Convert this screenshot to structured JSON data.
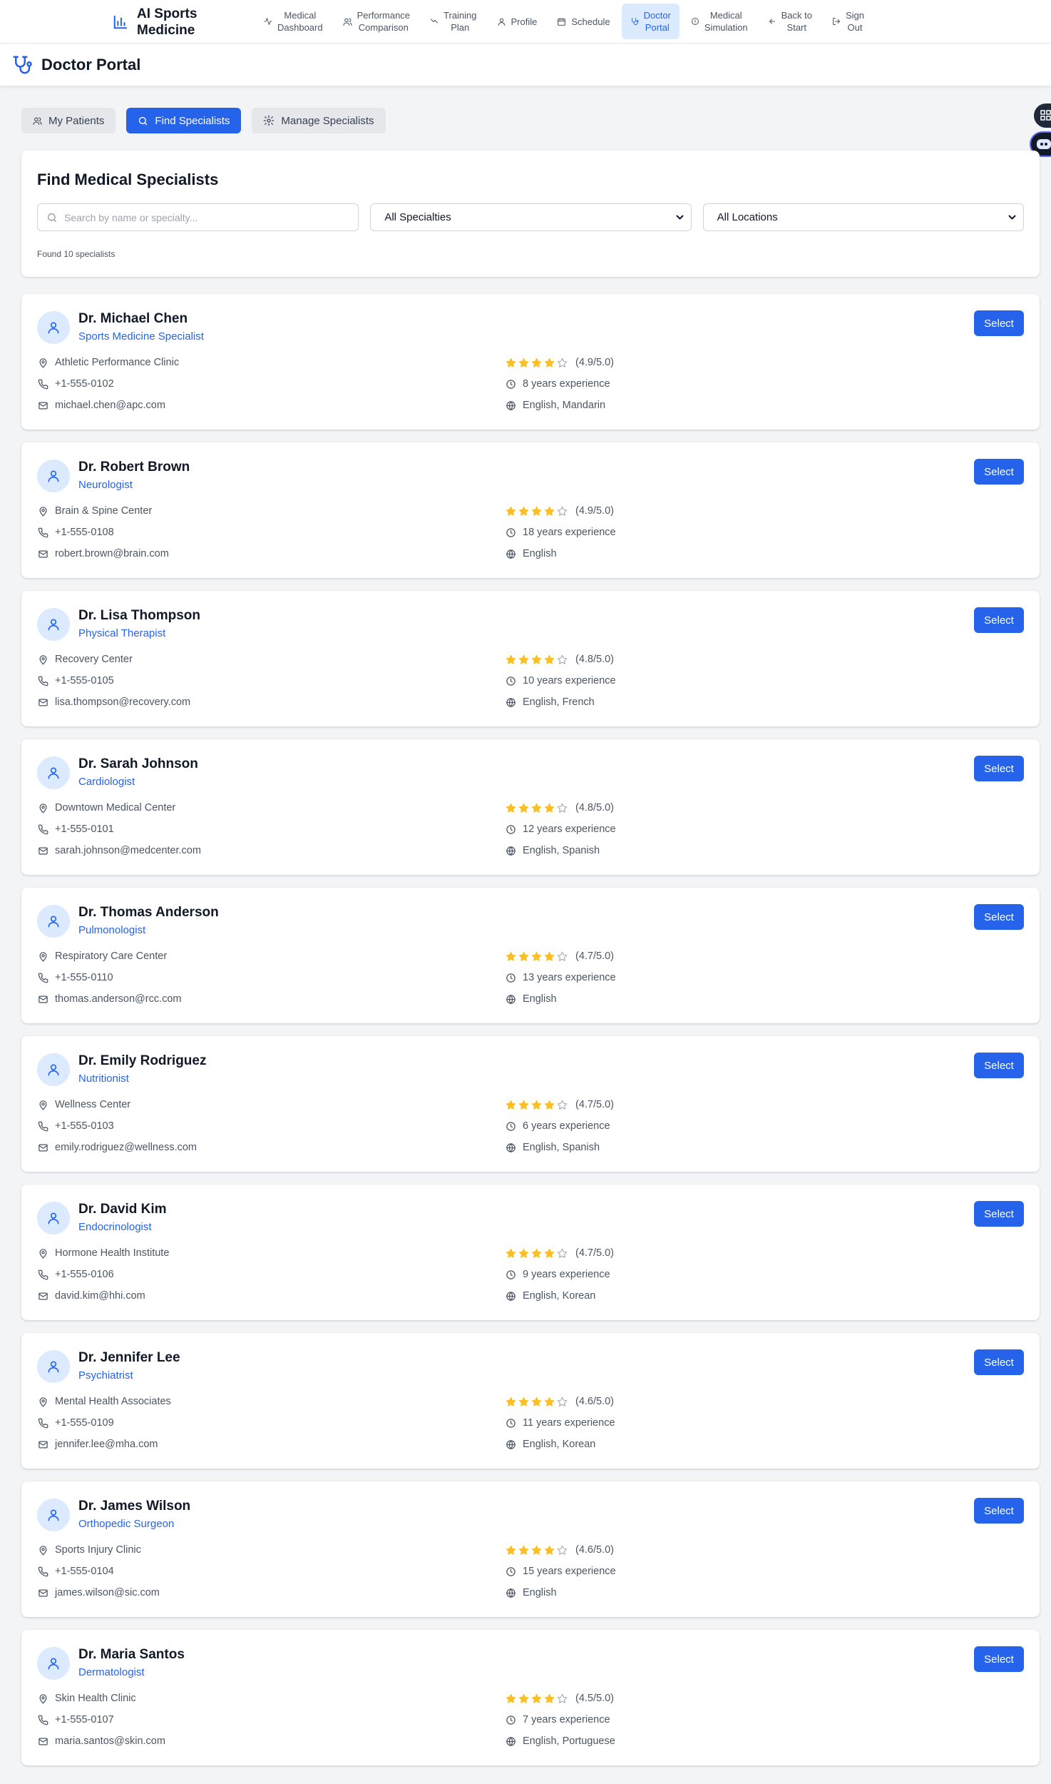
{
  "brand": {
    "line1": "AI Sports",
    "line2": "Medicine"
  },
  "nav": [
    {
      "line1": "Medical",
      "line2": "Dashboard",
      "icon": "activity-icon",
      "active": false
    },
    {
      "line1": "Performance",
      "line2": "Comparison",
      "icon": "users-icon",
      "active": false
    },
    {
      "line1": "Training",
      "line2": "Plan",
      "icon": "trend-icon",
      "active": false
    },
    {
      "line1": "Profile",
      "line2": "",
      "icon": "user-icon",
      "active": false
    },
    {
      "line1": "Schedule",
      "line2": "",
      "icon": "calendar-icon",
      "active": false
    },
    {
      "line1": "Doctor",
      "line2": "Portal",
      "icon": "stethoscope-icon",
      "active": true
    },
    {
      "line1": "Medical",
      "line2": "Simulation",
      "icon": "info-icon",
      "active": false
    },
    {
      "line1": "Back to",
      "line2": "Start",
      "icon": "arrow-left-icon",
      "active": false
    },
    {
      "line1": "Sign",
      "line2": "Out",
      "icon": "logout-icon",
      "active": false
    }
  ],
  "portal": {
    "title": "Doctor Portal"
  },
  "tabs": [
    {
      "label": "My Patients",
      "icon": "users-icon",
      "active": false
    },
    {
      "label": "Find Specialists",
      "icon": "search-icon",
      "active": true
    },
    {
      "label": "Manage Specialists",
      "icon": "gear-icon",
      "active": false
    }
  ],
  "search": {
    "title": "Find Medical Specialists",
    "placeholder": "Search by name or specialty...",
    "specialty_value": "All Specialties",
    "location_value": "All Locations",
    "found_text": "Found 10 specialists"
  },
  "select_label": "Select",
  "colors": {
    "primary": "#2563eb",
    "star": "#fbbf24",
    "star_empty": "#d1d5db"
  },
  "specialists": [
    {
      "name": "Dr. Michael Chen",
      "specialty": "Sports Medicine Specialist",
      "clinic": "Athletic Performance Clinic",
      "phone": "+1-555-0102",
      "email": "michael.chen@apc.com",
      "rating": "(4.9/5.0)",
      "stars": 4,
      "experience": "8 years experience",
      "languages": "English, Mandarin"
    },
    {
      "name": "Dr. Robert Brown",
      "specialty": "Neurologist",
      "clinic": "Brain & Spine Center",
      "phone": "+1-555-0108",
      "email": "robert.brown@brain.com",
      "rating": "(4.9/5.0)",
      "stars": 4,
      "experience": "18 years experience",
      "languages": "English"
    },
    {
      "name": "Dr. Lisa Thompson",
      "specialty": "Physical Therapist",
      "clinic": "Recovery Center",
      "phone": "+1-555-0105",
      "email": "lisa.thompson@recovery.com",
      "rating": "(4.8/5.0)",
      "stars": 4,
      "experience": "10 years experience",
      "languages": "English, French"
    },
    {
      "name": "Dr. Sarah Johnson",
      "specialty": "Cardiologist",
      "clinic": "Downtown Medical Center",
      "phone": "+1-555-0101",
      "email": "sarah.johnson@medcenter.com",
      "rating": "(4.8/5.0)",
      "stars": 4,
      "experience": "12 years experience",
      "languages": "English, Spanish"
    },
    {
      "name": "Dr. Thomas Anderson",
      "specialty": "Pulmonologist",
      "clinic": "Respiratory Care Center",
      "phone": "+1-555-0110",
      "email": "thomas.anderson@rcc.com",
      "rating": "(4.7/5.0)",
      "stars": 4,
      "experience": "13 years experience",
      "languages": "English"
    },
    {
      "name": "Dr. Emily Rodriguez",
      "specialty": "Nutritionist",
      "clinic": "Wellness Center",
      "phone": "+1-555-0103",
      "email": "emily.rodriguez@wellness.com",
      "rating": "(4.7/5.0)",
      "stars": 4,
      "experience": "6 years experience",
      "languages": "English, Spanish"
    },
    {
      "name": "Dr. David Kim",
      "specialty": "Endocrinologist",
      "clinic": "Hormone Health Institute",
      "phone": "+1-555-0106",
      "email": "david.kim@hhi.com",
      "rating": "(4.7/5.0)",
      "stars": 4,
      "experience": "9 years experience",
      "languages": "English, Korean"
    },
    {
      "name": "Dr. Jennifer Lee",
      "specialty": "Psychiatrist",
      "clinic": "Mental Health Associates",
      "phone": "+1-555-0109",
      "email": "jennifer.lee@mha.com",
      "rating": "(4.6/5.0)",
      "stars": 4,
      "experience": "11 years experience",
      "languages": "English, Korean"
    },
    {
      "name": "Dr. James Wilson",
      "specialty": "Orthopedic Surgeon",
      "clinic": "Sports Injury Clinic",
      "phone": "+1-555-0104",
      "email": "james.wilson@sic.com",
      "rating": "(4.6/5.0)",
      "stars": 4,
      "experience": "15 years experience",
      "languages": "English"
    },
    {
      "name": "Dr. Maria Santos",
      "specialty": "Dermatologist",
      "clinic": "Skin Health Clinic",
      "phone": "+1-555-0107",
      "email": "maria.santos@skin.com",
      "rating": "(4.5/5.0)",
      "stars": 4,
      "experience": "7 years experience",
      "languages": "English, Portuguese"
    }
  ]
}
